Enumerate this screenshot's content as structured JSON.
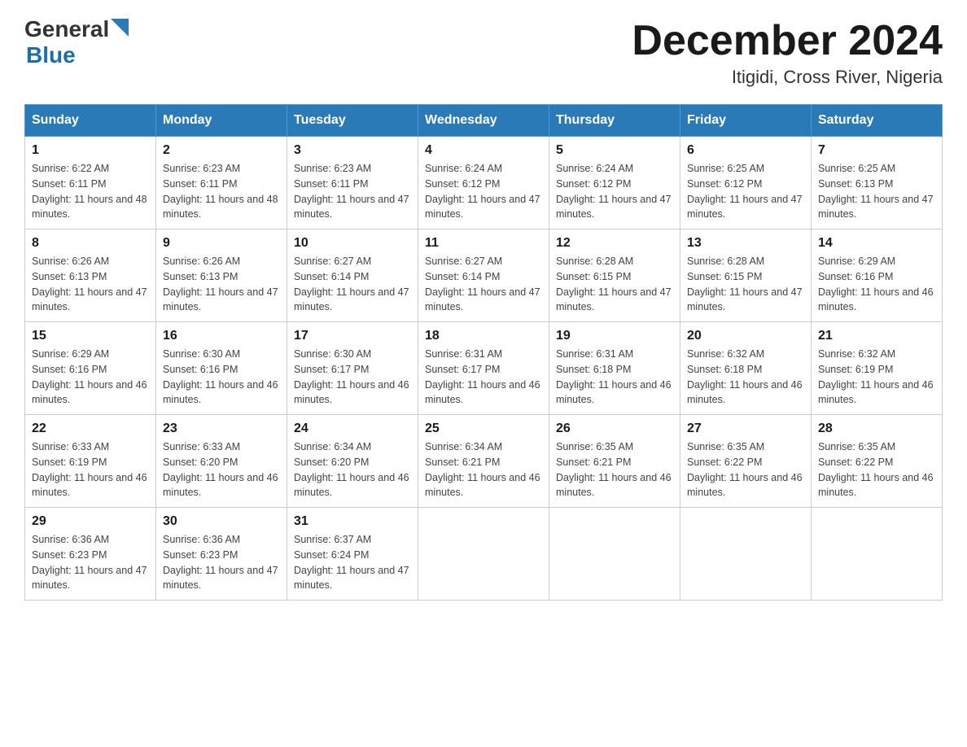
{
  "header": {
    "logo_general": "General",
    "logo_blue": "Blue",
    "title": "December 2024",
    "location": "Itigidi, Cross River, Nigeria"
  },
  "days_of_week": [
    "Sunday",
    "Monday",
    "Tuesday",
    "Wednesday",
    "Thursday",
    "Friday",
    "Saturday"
  ],
  "weeks": [
    [
      {
        "day": "1",
        "sunrise": "6:22 AM",
        "sunset": "6:11 PM",
        "daylight": "11 hours and 48 minutes."
      },
      {
        "day": "2",
        "sunrise": "6:23 AM",
        "sunset": "6:11 PM",
        "daylight": "11 hours and 48 minutes."
      },
      {
        "day": "3",
        "sunrise": "6:23 AM",
        "sunset": "6:11 PM",
        "daylight": "11 hours and 47 minutes."
      },
      {
        "day": "4",
        "sunrise": "6:24 AM",
        "sunset": "6:12 PM",
        "daylight": "11 hours and 47 minutes."
      },
      {
        "day": "5",
        "sunrise": "6:24 AM",
        "sunset": "6:12 PM",
        "daylight": "11 hours and 47 minutes."
      },
      {
        "day": "6",
        "sunrise": "6:25 AM",
        "sunset": "6:12 PM",
        "daylight": "11 hours and 47 minutes."
      },
      {
        "day": "7",
        "sunrise": "6:25 AM",
        "sunset": "6:13 PM",
        "daylight": "11 hours and 47 minutes."
      }
    ],
    [
      {
        "day": "8",
        "sunrise": "6:26 AM",
        "sunset": "6:13 PM",
        "daylight": "11 hours and 47 minutes."
      },
      {
        "day": "9",
        "sunrise": "6:26 AM",
        "sunset": "6:13 PM",
        "daylight": "11 hours and 47 minutes."
      },
      {
        "day": "10",
        "sunrise": "6:27 AM",
        "sunset": "6:14 PM",
        "daylight": "11 hours and 47 minutes."
      },
      {
        "day": "11",
        "sunrise": "6:27 AM",
        "sunset": "6:14 PM",
        "daylight": "11 hours and 47 minutes."
      },
      {
        "day": "12",
        "sunrise": "6:28 AM",
        "sunset": "6:15 PM",
        "daylight": "11 hours and 47 minutes."
      },
      {
        "day": "13",
        "sunrise": "6:28 AM",
        "sunset": "6:15 PM",
        "daylight": "11 hours and 47 minutes."
      },
      {
        "day": "14",
        "sunrise": "6:29 AM",
        "sunset": "6:16 PM",
        "daylight": "11 hours and 46 minutes."
      }
    ],
    [
      {
        "day": "15",
        "sunrise": "6:29 AM",
        "sunset": "6:16 PM",
        "daylight": "11 hours and 46 minutes."
      },
      {
        "day": "16",
        "sunrise": "6:30 AM",
        "sunset": "6:16 PM",
        "daylight": "11 hours and 46 minutes."
      },
      {
        "day": "17",
        "sunrise": "6:30 AM",
        "sunset": "6:17 PM",
        "daylight": "11 hours and 46 minutes."
      },
      {
        "day": "18",
        "sunrise": "6:31 AM",
        "sunset": "6:17 PM",
        "daylight": "11 hours and 46 minutes."
      },
      {
        "day": "19",
        "sunrise": "6:31 AM",
        "sunset": "6:18 PM",
        "daylight": "11 hours and 46 minutes."
      },
      {
        "day": "20",
        "sunrise": "6:32 AM",
        "sunset": "6:18 PM",
        "daylight": "11 hours and 46 minutes."
      },
      {
        "day": "21",
        "sunrise": "6:32 AM",
        "sunset": "6:19 PM",
        "daylight": "11 hours and 46 minutes."
      }
    ],
    [
      {
        "day": "22",
        "sunrise": "6:33 AM",
        "sunset": "6:19 PM",
        "daylight": "11 hours and 46 minutes."
      },
      {
        "day": "23",
        "sunrise": "6:33 AM",
        "sunset": "6:20 PM",
        "daylight": "11 hours and 46 minutes."
      },
      {
        "day": "24",
        "sunrise": "6:34 AM",
        "sunset": "6:20 PM",
        "daylight": "11 hours and 46 minutes."
      },
      {
        "day": "25",
        "sunrise": "6:34 AM",
        "sunset": "6:21 PM",
        "daylight": "11 hours and 46 minutes."
      },
      {
        "day": "26",
        "sunrise": "6:35 AM",
        "sunset": "6:21 PM",
        "daylight": "11 hours and 46 minutes."
      },
      {
        "day": "27",
        "sunrise": "6:35 AM",
        "sunset": "6:22 PM",
        "daylight": "11 hours and 46 minutes."
      },
      {
        "day": "28",
        "sunrise": "6:35 AM",
        "sunset": "6:22 PM",
        "daylight": "11 hours and 46 minutes."
      }
    ],
    [
      {
        "day": "29",
        "sunrise": "6:36 AM",
        "sunset": "6:23 PM",
        "daylight": "11 hours and 47 minutes."
      },
      {
        "day": "30",
        "sunrise": "6:36 AM",
        "sunset": "6:23 PM",
        "daylight": "11 hours and 47 minutes."
      },
      {
        "day": "31",
        "sunrise": "6:37 AM",
        "sunset": "6:24 PM",
        "daylight": "11 hours and 47 minutes."
      },
      null,
      null,
      null,
      null
    ]
  ]
}
